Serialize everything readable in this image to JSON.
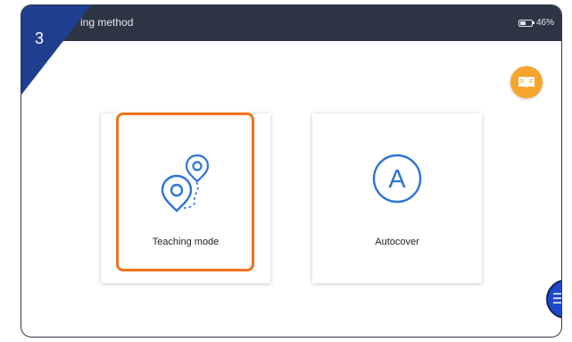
{
  "step": {
    "number": "3"
  },
  "header": {
    "title": "ing method",
    "battery_percent": "46%",
    "battery_level": 0.46
  },
  "cards": [
    {
      "label": "Teaching mode",
      "icon": "location-route-icon",
      "selected": true
    },
    {
      "label": "Autocover",
      "icon": "letter-a-circle-icon",
      "selected": false
    }
  ],
  "autocover_icon_letter": "A",
  "icons": {
    "manual": "book-icon",
    "floating_menu": "menu-icon"
  },
  "colors": {
    "header_bg": "#2d3443",
    "step_badge": "#1f3e8f",
    "highlight": "#f0741c",
    "manual_button": "#f5a52c",
    "icon_blue": "#2e74d8",
    "float_menu": "#1f49c9"
  }
}
